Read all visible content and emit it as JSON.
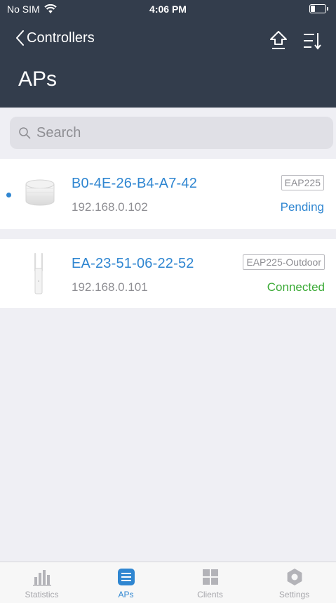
{
  "status_bar": {
    "carrier": "No SIM",
    "time": "4:06 PM"
  },
  "nav": {
    "back_label": "Controllers",
    "title": "APs"
  },
  "search": {
    "placeholder": "Search",
    "value": ""
  },
  "access_points": [
    {
      "mac": "B0-4E-26-B4-A7-42",
      "ip": "192.168.0.102",
      "model": "EAP225",
      "status": "Pending",
      "status_color": "#2f86d1",
      "is_new": true,
      "device_icon": "ceiling-ap-icon"
    },
    {
      "mac": "EA-23-51-06-22-52",
      "ip": "192.168.0.101",
      "model": "EAP225-Outdoor",
      "status": "Connected",
      "status_color": "#3aaa35",
      "is_new": false,
      "device_icon": "outdoor-ap-icon"
    }
  ],
  "tabs": [
    {
      "label": "Statistics",
      "icon": "bar-chart-icon",
      "active": false
    },
    {
      "label": "APs",
      "icon": "list-icon",
      "active": true
    },
    {
      "label": "Clients",
      "icon": "grid-icon",
      "active": false
    },
    {
      "label": "Settings",
      "icon": "gear-icon",
      "active": false
    }
  ],
  "colors": {
    "header_bg": "#333d4c",
    "accent": "#2f86d1",
    "connected": "#3aaa35",
    "page_bg": "#efeff4"
  }
}
